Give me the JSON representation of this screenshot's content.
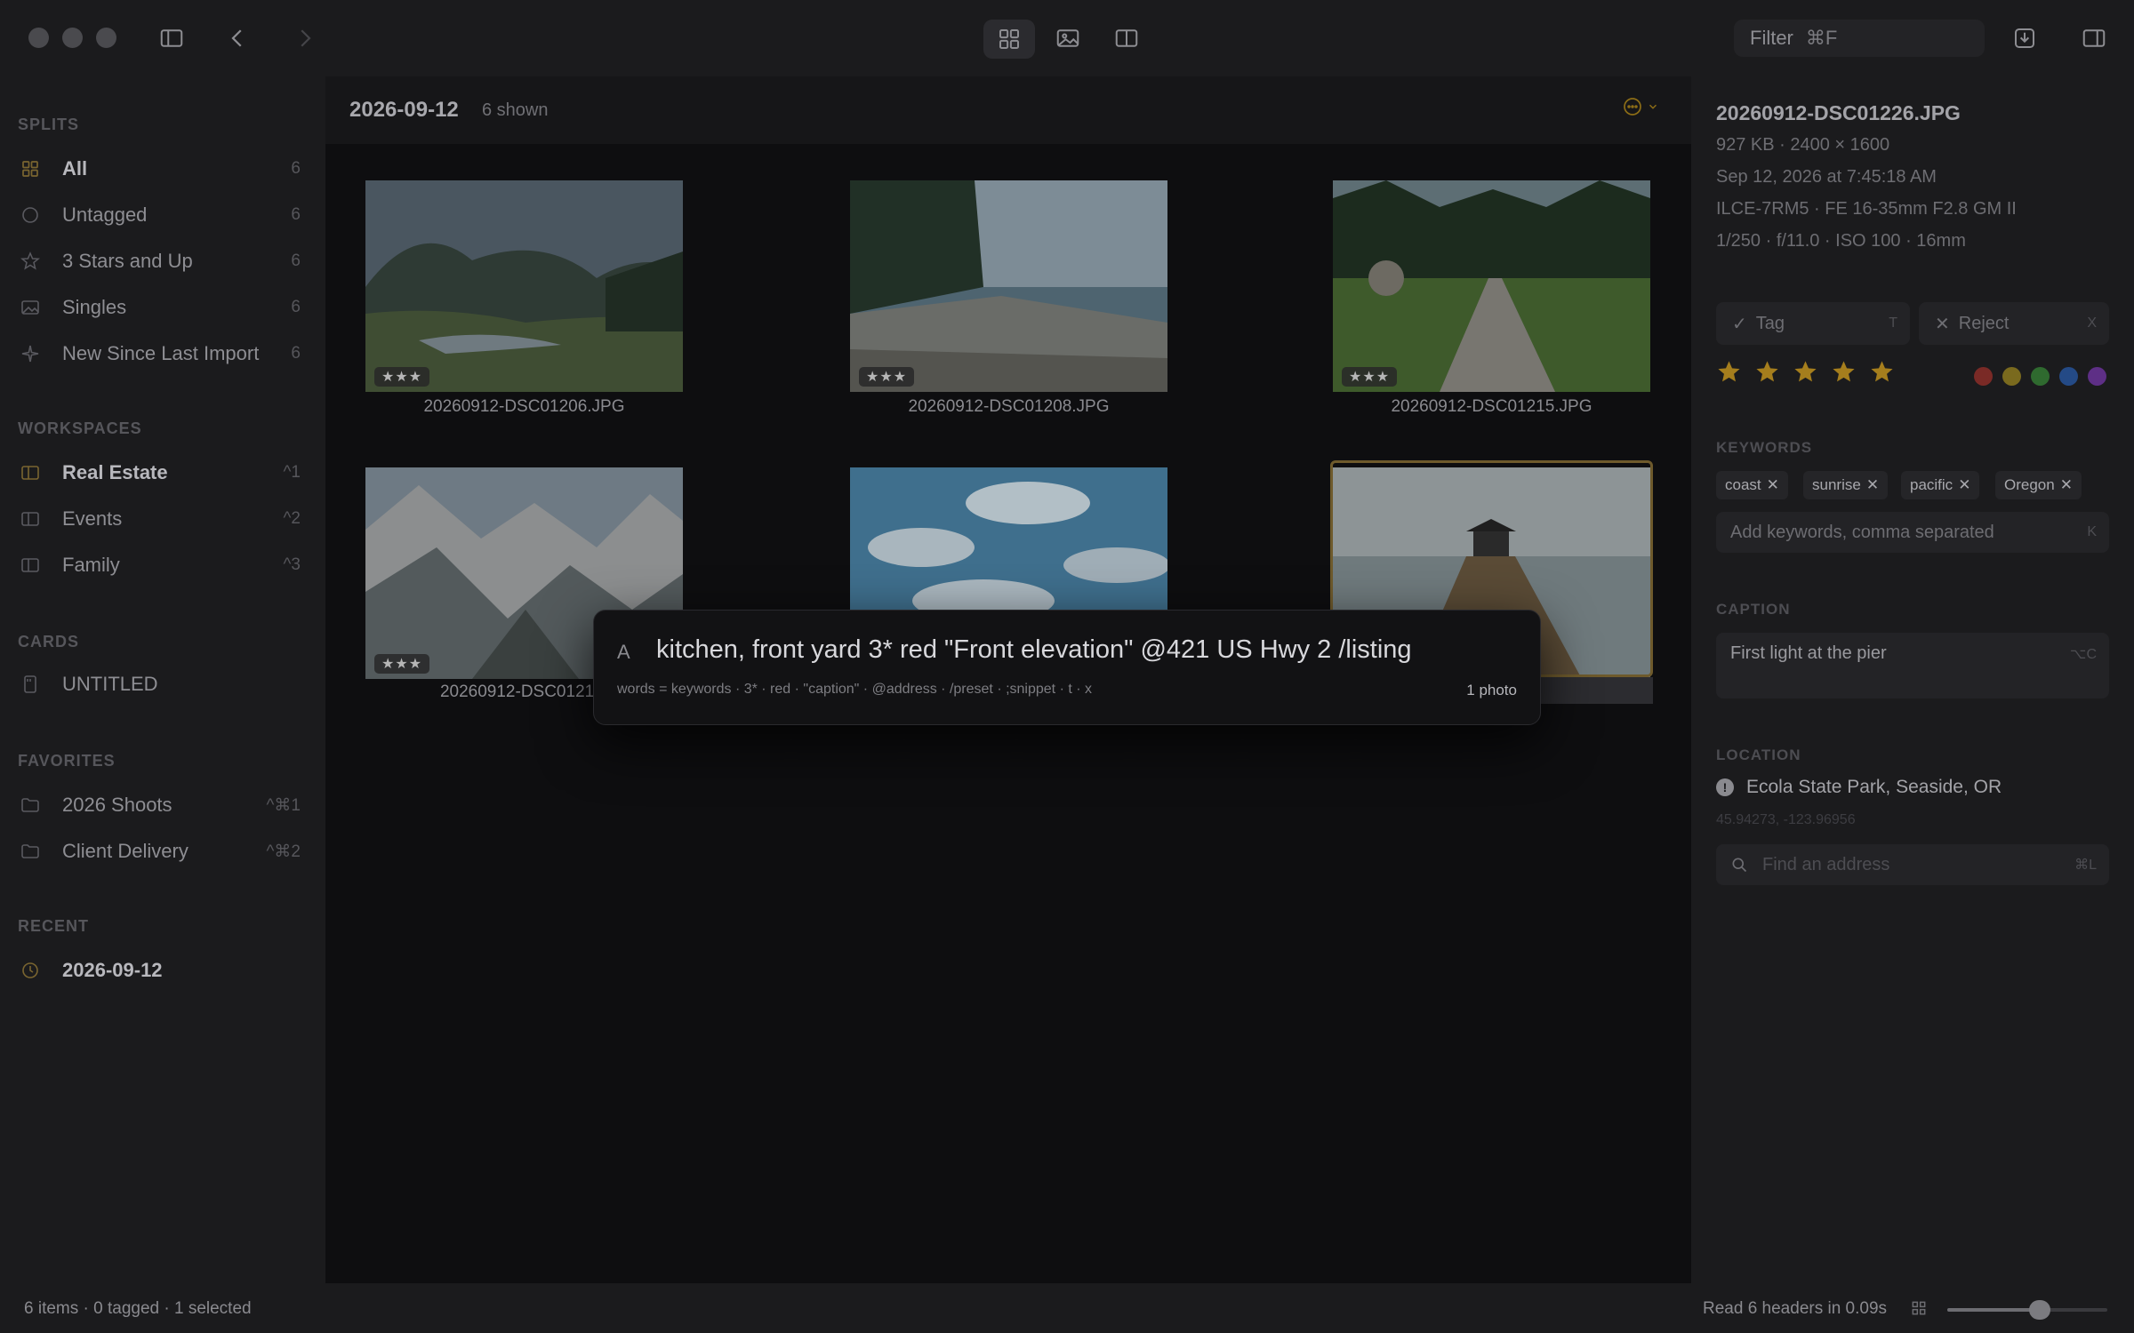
{
  "titlebar": {
    "filter_label": "Filter",
    "filter_shortcut": "⌘F"
  },
  "sidebar": {
    "splits_title": "SPLITS",
    "splits": [
      {
        "label": "All",
        "count": "6",
        "icon": "grid-icon"
      },
      {
        "label": "Untagged",
        "count": "6",
        "icon": "circle-icon"
      },
      {
        "label": "3 Stars and Up",
        "count": "6",
        "icon": "star-icon"
      },
      {
        "label": "Singles",
        "count": "6",
        "icon": "image-icon"
      },
      {
        "label": "New Since Last Import",
        "count": "6",
        "icon": "sparkle-icon"
      }
    ],
    "workspaces_title": "WORKSPACES",
    "workspaces": [
      {
        "label": "Real Estate",
        "shortcut": "^1"
      },
      {
        "label": "Events",
        "shortcut": "^2"
      },
      {
        "label": "Family",
        "shortcut": "^3"
      }
    ],
    "cards_title": "CARDS",
    "cards": [
      {
        "label": "UNTITLED"
      }
    ],
    "favorites_title": "FAVORITES",
    "favorites": [
      {
        "label": "2026 Shoots",
        "shortcut": "^⌘1"
      },
      {
        "label": "Client Delivery",
        "shortcut": "^⌘2"
      }
    ],
    "recent_title": "RECENT",
    "recent": [
      {
        "label": "2026-09-12"
      }
    ]
  },
  "content": {
    "title": "2026-09-12",
    "count": "6 shown",
    "photos": [
      {
        "name": "20260912-DSC01206.JPG",
        "rating": "★★★"
      },
      {
        "name": "20260912-DSC01208.JPG",
        "rating": "★★★"
      },
      {
        "name": "20260912-DSC01215.JPG",
        "rating": "★★★"
      },
      {
        "name": "20260912-DSC01219.",
        "rating": "★★★"
      },
      {
        "name": "",
        "rating": ""
      },
      {
        "name": "26.JPG",
        "rating": ""
      }
    ]
  },
  "palette": {
    "cursor": "A",
    "input": "kitchen, front yard 3* red \"Front elevation\" @421 US Hwy 2 /listing",
    "hint": "words = keywords · 3* · red · \"caption\" · @address · /preset · ;snippet · t · x",
    "count": "1 photo"
  },
  "inspector": {
    "filename": "20260912-DSC01226.JPG",
    "size": "927 KB  ·  2400 × 1600",
    "date": "Sep 12, 2026 at 7:45:18 AM",
    "camera": "ILCE-7RM5  ·  FE 16-35mm F2.8 GM II",
    "exposure": "1/250 · f/11.0 · ISO 100 · 16mm",
    "tag_label": "Tag",
    "tag_key": "T",
    "reject_label": "Reject",
    "reject_key": "X",
    "rating": 5,
    "colors": [
      "#7a2a26",
      "#7a6a1e",
      "#2f6a2f",
      "#244a86",
      "#5e2f86"
    ],
    "keywords_title": "KEYWORDS",
    "keywords": [
      "coast",
      "sunrise",
      "pacific",
      "Oregon"
    ],
    "keywords_placeholder": "Add keywords, comma separated",
    "keywords_key": "K",
    "caption_title": "CAPTION",
    "caption": "First light at the pier",
    "caption_key": "⌥C",
    "location_title": "LOCATION",
    "location_name": "Ecola State Park, Seaside, OR",
    "location_coords": "45.94273, -123.96956",
    "address_placeholder": "Find an address",
    "address_key": "⌘L"
  },
  "statusbar": {
    "left": "6 items · 0 tagged · 1 selected",
    "right": "Read 6 headers in 0.09s",
    "zoom_fraction": 0.58
  }
}
